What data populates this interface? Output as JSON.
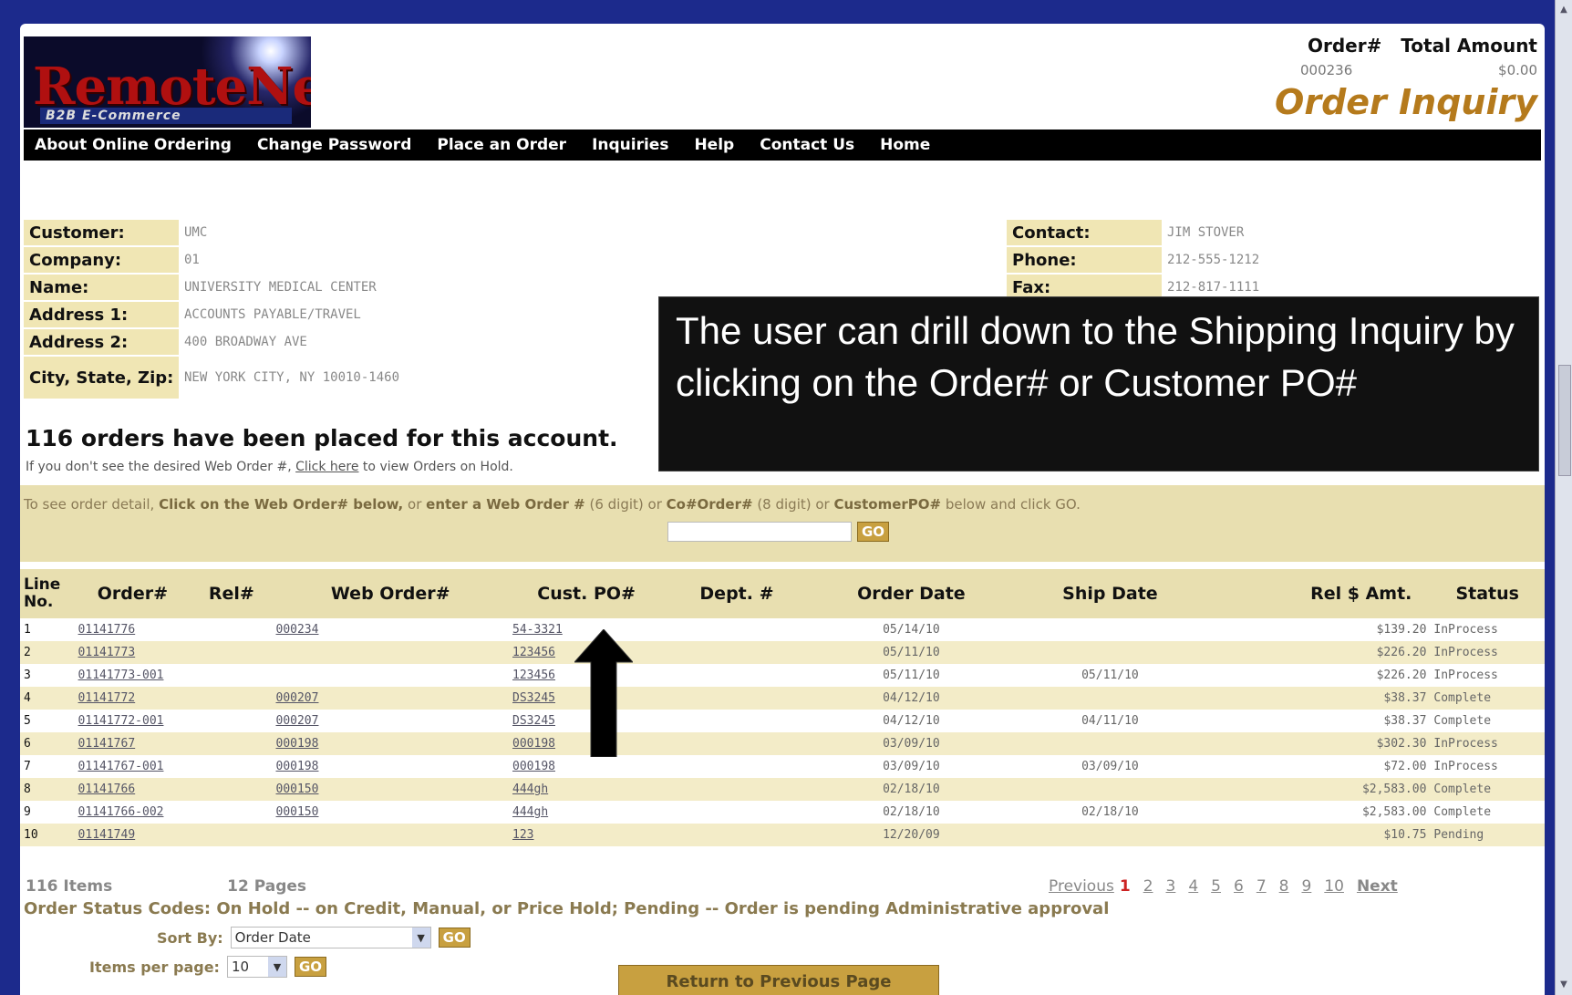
{
  "header": {
    "logo_text": "RemoteNet",
    "logo_tagline": "B2B E-Commerce",
    "col_order": "Order#",
    "col_total": "Total Amount",
    "order_number": "000236",
    "total_amount": "$0.00",
    "page_title": "Order Inquiry"
  },
  "nav": [
    "About Online Ordering",
    "Change Password",
    "Place an Order",
    "Inquiries",
    "Help",
    "Contact Us",
    "Home"
  ],
  "customer_info": [
    {
      "label": "Customer:",
      "value": "UMC"
    },
    {
      "label": "Company:",
      "value": "01"
    },
    {
      "label": "Name:",
      "value": "UNIVERSITY MEDICAL CENTER"
    },
    {
      "label": "Address 1:",
      "value": "ACCOUNTS PAYABLE/TRAVEL"
    },
    {
      "label": "Address 2:",
      "value": "400 BROADWAY AVE"
    },
    {
      "label": "City, State, Zip:",
      "value": "NEW YORK CITY, NY 10010-1460"
    }
  ],
  "contact_info": [
    {
      "label": "Contact:",
      "value": "JIM STOVER"
    },
    {
      "label": "Phone:",
      "value": "212-555-1212"
    },
    {
      "label": "Fax:",
      "value": "212-817-1111"
    }
  ],
  "summary": {
    "headline": "116 orders have been placed for this account.",
    "hold_prefix": "If you don't see the desired Web Order #, ",
    "hold_link": "Click here",
    "hold_suffix": " to view Orders on Hold."
  },
  "search": {
    "instr_prefix": "To see order detail, ",
    "instr_bold1": "Click on the Web Order# below,",
    "instr_mid1": " or ",
    "instr_bold2": "enter a Web Order #",
    "instr_mid2": " (6 digit) or ",
    "instr_bold3": "Co#Order#",
    "instr_mid3": " (8 digit) or ",
    "instr_bold4": "CustomerPO#",
    "instr_suffix": " below and click GO.",
    "go_label": "GO"
  },
  "table": {
    "headers": [
      "Line No.",
      "Order#",
      "Rel#",
      "Web Order#",
      "Cust. PO#",
      "Dept. #",
      "Order Date",
      "Ship Date",
      "Rel $ Amt.",
      "Status"
    ],
    "rows": [
      {
        "line": "1",
        "order": "01141776",
        "web": "000234",
        "po": "54-3321",
        "odate": "05/14/10",
        "sdate": "",
        "amt": "$139.20",
        "status": "InProcess"
      },
      {
        "line": "2",
        "order": "01141773",
        "web": "",
        "po": "123456",
        "odate": "05/11/10",
        "sdate": "",
        "amt": "$226.20",
        "status": "InProcess"
      },
      {
        "line": "3",
        "order": "01141773-001",
        "web": "",
        "po": "123456",
        "odate": "05/11/10",
        "sdate": "05/11/10",
        "amt": "$226.20",
        "status": "InProcess"
      },
      {
        "line": "4",
        "order": "01141772",
        "web": "000207",
        "po": "DS3245",
        "odate": "04/12/10",
        "sdate": "",
        "amt": "$38.37",
        "status": "Complete"
      },
      {
        "line": "5",
        "order": "01141772-001",
        "web": "000207",
        "po": "DS3245",
        "odate": "04/12/10",
        "sdate": "04/11/10",
        "amt": "$38.37",
        "status": "Complete"
      },
      {
        "line": "6",
        "order": "01141767",
        "web": "000198",
        "po": "000198",
        "odate": "03/09/10",
        "sdate": "",
        "amt": "$302.30",
        "status": "InProcess"
      },
      {
        "line": "7",
        "order": "01141767-001",
        "web": "000198",
        "po": "000198",
        "odate": "03/09/10",
        "sdate": "03/09/10",
        "amt": "$72.00",
        "status": "InProcess"
      },
      {
        "line": "8",
        "order": "01141766",
        "web": "000150",
        "po": "444gh",
        "odate": "02/18/10",
        "sdate": "",
        "amt": "$2,583.00",
        "status": "Complete"
      },
      {
        "line": "9",
        "order": "01141766-002",
        "web": "000150",
        "po": "444gh",
        "odate": "02/18/10",
        "sdate": "02/18/10",
        "amt": "$2,583.00",
        "status": "Complete"
      },
      {
        "line": "10",
        "order": "01141749",
        "web": "",
        "po": "123",
        "odate": "12/20/09",
        "sdate": "",
        "amt": "$10.75",
        "status": "Pending"
      }
    ]
  },
  "footer": {
    "items": "116 Items",
    "pages": "12 Pages",
    "previous": "Previous",
    "current_page": "1",
    "page_links": [
      "2",
      "3",
      "4",
      "5",
      "6",
      "7",
      "8",
      "9",
      "10"
    ],
    "next": "Next",
    "status_codes": "Order Status Codes: On Hold -- on Credit, Manual, or Price Hold; Pending -- Order is pending Administrative approval",
    "sort_label": "Sort By:",
    "sort_value": "Order Date",
    "per_page_label": "Items per page:",
    "per_page_value": "10",
    "go_label": "GO",
    "return_label": "Return to Previous Page"
  },
  "callout": {
    "text": "The user can drill down to the Shipping Inquiry by clicking on the Order# or Customer PO#"
  }
}
